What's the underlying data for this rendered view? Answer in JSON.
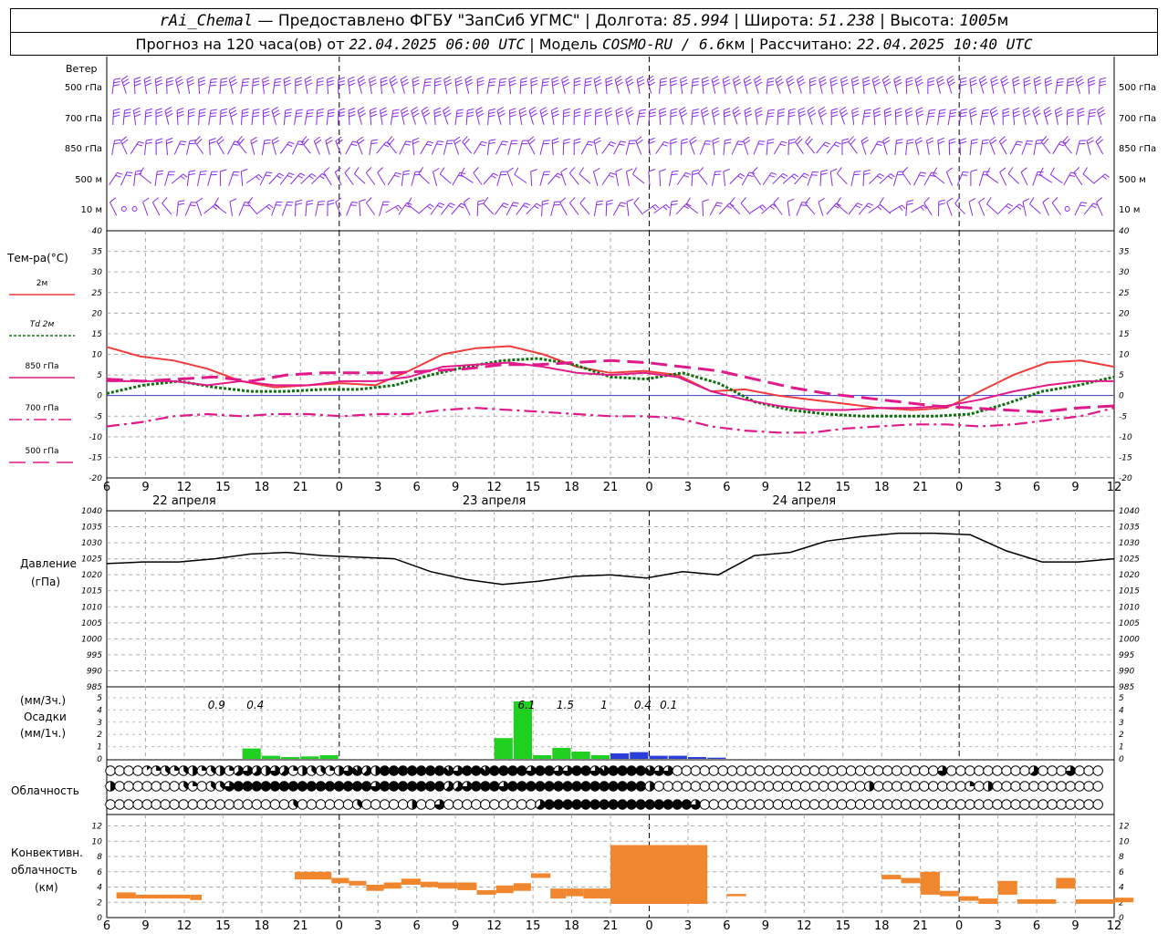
{
  "header": {
    "station": "rAi_Chemal",
    "provider": "— Предоставлено ФГБУ \"ЗапСиб УГМС\"",
    "lon_label": "| Долгота:",
    "lon_value": "85.994",
    "lat_label": "| Широта:",
    "lat_value": "51.238",
    "alt_label": "| Высота:",
    "alt_value": "1005",
    "alt_unit": "м",
    "forecast_label": "Прогноз на 120 часа(ов) от",
    "forecast_start": "22.04.2025 06:00 UTC",
    "model_label": "| Модель",
    "model_name": "COSMO-RU / 6.6",
    "model_unit": "км",
    "calc_label": "| Рассчитано:",
    "calc_time": "22.04.2025 10:40 UTC"
  },
  "wind_panel": {
    "title": "Ветер",
    "levels": [
      "500 гПа",
      "700 гПа",
      "850 гПа",
      "500 м",
      "10 м"
    ],
    "right_levels": [
      "500 гПа",
      "700 гПа",
      "850 гПа",
      "500 м",
      "10 м"
    ]
  },
  "temp_panel": {
    "title": "Тем-ра(°C)",
    "legend": [
      {
        "label": "2м",
        "color": "#f03c3c",
        "style": "solid"
      },
      {
        "label": "Td  2м",
        "color": "#107010",
        "style": "dotted"
      },
      {
        "label": "850 гПа",
        "color": "#e01a8a",
        "style": "solid"
      },
      {
        "label": "700 гПа",
        "color": "#e01a8a",
        "style": "dashdot"
      },
      {
        "label": "500 гПа",
        "color": "#e01a8a",
        "style": "dashed"
      }
    ]
  },
  "pressure_panel": {
    "title": "Давление",
    "unit": "(гПа)"
  },
  "precip_panel": {
    "unit_3h": "(мм/3ч.)",
    "title": "Осадки",
    "unit_1h": "(мм/1ч.)"
  },
  "cloud_panel": {
    "title": "Облачность"
  },
  "conv_panel": {
    "title_1": "Конвективн.",
    "title_2": "облачность",
    "unit": "(км)"
  },
  "time_axis": {
    "hours": [
      "6",
      "9",
      "12",
      "15",
      "18",
      "21",
      "0",
      "3",
      "6",
      "9",
      "12",
      "15",
      "18",
      "21",
      "0",
      "3",
      "6",
      "9",
      "12",
      "15",
      "18",
      "21",
      "0",
      "3",
      "6",
      "9",
      "12"
    ],
    "day_labels": [
      "22 апреля",
      "23 апреля",
      "24 апреля"
    ]
  },
  "chart_data": [
    {
      "type": "line",
      "name": "temperature",
      "x_hours": [
        0,
        3,
        6,
        9,
        12,
        15,
        18,
        21,
        24,
        27,
        30,
        33,
        36,
        39,
        42,
        45,
        48,
        51,
        54,
        57,
        60,
        63,
        66,
        69,
        72,
        75,
        78
      ],
      "ylim": [
        -20,
        40
      ],
      "yticks": [
        -20,
        -15,
        -10,
        -5,
        0,
        5,
        10,
        15,
        20,
        25,
        30,
        35,
        40
      ],
      "series": [
        {
          "name": "2м",
          "color": "#f03c3c",
          "style": "solid",
          "values": [
            11.8,
            9.5,
            8.5,
            6.5,
            3.5,
            2,
            2.5,
            3,
            2.5,
            6,
            10,
            11.5,
            12,
            10,
            7,
            5.5,
            6,
            5,
            1,
            1.5,
            0,
            -1,
            -2,
            -3,
            -3.5,
            -3,
            1,
            5,
            8,
            8.5,
            7
          ]
        },
        {
          "name": "Td 2м",
          "color": "#107010",
          "style": "dotted",
          "values": [
            0.5,
            2.5,
            3.5,
            2,
            1,
            1,
            1.5,
            1.5,
            2.5,
            5,
            7,
            8.5,
            9,
            7.5,
            4.5,
            4,
            5.5,
            3,
            -1.5,
            -3.5,
            -4.5,
            -5,
            -5,
            -5,
            -4.5,
            -2,
            1,
            2.5,
            4.5
          ]
        },
        {
          "name": "850 гПа",
          "color": "#e01a8a",
          "style": "solid",
          "values": [
            3.5,
            3.5,
            3.5,
            2.5,
            3.5,
            2.5,
            2.5,
            3.5,
            3.5,
            4.5,
            7,
            7.5,
            8,
            7,
            5.5,
            5,
            5.5,
            4.5,
            1,
            -1,
            -2.5,
            -3.5,
            -3.5,
            -3,
            -3,
            -2.5,
            -1,
            1,
            2.5,
            3.5,
            3.5
          ]
        },
        {
          "name": "700 гПа",
          "color": "#e01a8a",
          "style": "dashdot",
          "values": [
            -7.5,
            -6.5,
            -5,
            -4.5,
            -5,
            -4.5,
            -4.5,
            -5,
            -4.5,
            -4.5,
            -3.5,
            -3,
            -3.5,
            -4,
            -4.5,
            -5,
            -5,
            -5.5,
            -7.5,
            -8.5,
            -9,
            -9,
            -8,
            -7.5,
            -7,
            -7,
            -7.5,
            -7,
            -6,
            -5,
            -3
          ]
        },
        {
          "name": "500 гПа",
          "color": "#e01a8a",
          "style": "dashed",
          "values": [
            4,
            3.5,
            4,
            4.5,
            3.5,
            5,
            5.5,
            5.5,
            5.5,
            6,
            6.5,
            7.5,
            7.5,
            8,
            8.5,
            8,
            7,
            6,
            4,
            2,
            0.5,
            -0.5,
            -1.5,
            -2.5,
            -3,
            -3.5,
            -4,
            -3,
            -2.5
          ]
        }
      ]
    },
    {
      "type": "line",
      "name": "pressure",
      "ylim": [
        985,
        1040
      ],
      "yticks": [
        985,
        990,
        995,
        1000,
        1005,
        1010,
        1015,
        1020,
        1025,
        1030,
        1035,
        1040
      ],
      "values": [
        1023.5,
        1024,
        1024,
        1025,
        1026.5,
        1027,
        1026,
        1025.5,
        1025,
        1021,
        1018.5,
        1017,
        1018,
        1019.5,
        1020,
        1019,
        1021,
        1020,
        1026,
        1027,
        1030.5,
        1032,
        1033,
        1033,
        1032.5,
        1027.5,
        1024,
        1024,
        1025
      ]
    },
    {
      "type": "bar",
      "name": "precipitation",
      "ylim": [
        0,
        5
      ],
      "yticks": [
        0,
        1,
        2,
        3,
        4,
        5
      ],
      "labels": [
        {
          "hour": 8.5,
          "text": "0.9"
        },
        {
          "hour": 11.5,
          "text": "0.4"
        },
        {
          "hour": 32.5,
          "text": "6.1"
        },
        {
          "hour": 35.5,
          "text": "1.5"
        },
        {
          "hour": 38.5,
          "text": "1"
        },
        {
          "hour": 41.5,
          "text": "0.4"
        },
        {
          "hour": 43.5,
          "text": "0.1"
        }
      ],
      "bars": [
        {
          "h0": 7,
          "h1": 8,
          "v": 0.85,
          "c": "#20d020"
        },
        {
          "h0": 8,
          "h1": 9,
          "v": 0.25,
          "c": "#20d020"
        },
        {
          "h0": 9,
          "h1": 10,
          "v": 0.15,
          "c": "#20d020"
        },
        {
          "h0": 10,
          "h1": 11,
          "v": 0.2,
          "c": "#20d020"
        },
        {
          "h0": 11,
          "h1": 12,
          "v": 0.3,
          "c": "#20d020"
        },
        {
          "h0": 20,
          "h1": 21,
          "v": 1.7,
          "c": "#20d020"
        },
        {
          "h0": 21,
          "h1": 22,
          "v": 4.7,
          "c": "#20d020"
        },
        {
          "h0": 22,
          "h1": 23,
          "v": 0.3,
          "c": "#20d020"
        },
        {
          "h0": 23,
          "h1": 24,
          "v": 0.9,
          "c": "#20d020"
        },
        {
          "h0": 24,
          "h1": 25,
          "v": 0.6,
          "c": "#20d020"
        },
        {
          "h0": 25,
          "h1": 26,
          "v": 0.3,
          "c": "#20d020"
        },
        {
          "h0": 26,
          "h1": 27,
          "v": 0.45,
          "c": "#2b3fd8"
        },
        {
          "h0": 27,
          "h1": 28,
          "v": 0.55,
          "c": "#2b3fd8"
        },
        {
          "h0": 28,
          "h1": 29,
          "v": 0.25,
          "c": "#2b3fd8"
        },
        {
          "h0": 29,
          "h1": 30,
          "v": 0.25,
          "c": "#2b3fd8"
        },
        {
          "h0": 30,
          "h1": 31,
          "v": 0.15,
          "c": "#2b3fd8"
        },
        {
          "h0": 31,
          "h1": 32,
          "v": 0.1,
          "c": "#2b3fd8"
        }
      ]
    },
    {
      "type": "bar",
      "name": "convective_cloud",
      "ylim": [
        0,
        12
      ],
      "yticks": [
        0,
        2,
        4,
        6,
        8,
        10,
        12
      ],
      "color": "#f0872e",
      "blocks": [
        {
          "h0": 0.5,
          "h1": 1.5,
          "lo": 2.5,
          "hi": 3.3
        },
        {
          "h0": 1.5,
          "h1": 4.3,
          "lo": 2.5,
          "hi": 3
        },
        {
          "h0": 4.3,
          "h1": 4.9,
          "lo": 2.3,
          "hi": 3
        },
        {
          "h0": 9.7,
          "h1": 11.6,
          "lo": 5,
          "hi": 6
        },
        {
          "h0": 11.6,
          "h1": 12.5,
          "lo": 4.5,
          "hi": 5.2
        },
        {
          "h0": 12.5,
          "h1": 13.4,
          "lo": 4.2,
          "hi": 4.8
        },
        {
          "h0": 13.4,
          "h1": 14.3,
          "lo": 3.5,
          "hi": 4.3
        },
        {
          "h0": 14.3,
          "h1": 15.2,
          "lo": 3.8,
          "hi": 4.6
        },
        {
          "h0": 15.2,
          "h1": 16.2,
          "lo": 4.3,
          "hi": 5.1
        },
        {
          "h0": 16.2,
          "h1": 17.1,
          "lo": 4,
          "hi": 4.7
        },
        {
          "h0": 17.1,
          "h1": 18.1,
          "lo": 3.8,
          "hi": 4.6
        },
        {
          "h0": 18.1,
          "h1": 19.1,
          "lo": 3.6,
          "hi": 4.6
        },
        {
          "h0": 19.1,
          "h1": 20.1,
          "lo": 3,
          "hi": 3.6
        },
        {
          "h0": 20.1,
          "h1": 21,
          "lo": 3.2,
          "hi": 4.2
        },
        {
          "h0": 21,
          "h1": 21.9,
          "lo": 3.5,
          "hi": 4.5
        },
        {
          "h0": 21.9,
          "h1": 22.9,
          "lo": 5.2,
          "hi": 5.8
        },
        {
          "h0": 22.9,
          "h1": 23.7,
          "lo": 2.5,
          "hi": 3.8
        },
        {
          "h0": 23.7,
          "h1": 24.6,
          "lo": 2.8,
          "hi": 3.8
        },
        {
          "h0": 24.6,
          "h1": 26,
          "lo": 2.5,
          "hi": 3.8
        },
        {
          "h0": 26,
          "h1": 31,
          "lo": 1.8,
          "hi": 9.5
        },
        {
          "h0": 32,
          "h1": 33,
          "lo": 2.8,
          "hi": 3.1
        },
        {
          "h0": 40,
          "h1": 41,
          "lo": 5,
          "hi": 5.6
        },
        {
          "h0": 41,
          "h1": 42,
          "lo": 4.5,
          "hi": 5.2
        },
        {
          "h0": 42,
          "h1": 43,
          "lo": 3,
          "hi": 6
        },
        {
          "h0": 43,
          "h1": 44,
          "lo": 2.8,
          "hi": 3.5
        },
        {
          "h0": 44,
          "h1": 45,
          "lo": 2.2,
          "hi": 2.8
        },
        {
          "h0": 45,
          "h1": 46,
          "lo": 1.8,
          "hi": 2.5
        },
        {
          "h0": 46,
          "h1": 47,
          "lo": 3,
          "hi": 4.8
        },
        {
          "h0": 47,
          "h1": 49,
          "lo": 1.8,
          "hi": 2.4
        },
        {
          "h0": 49,
          "h1": 50,
          "lo": 3.8,
          "hi": 5.2
        },
        {
          "h0": 50,
          "h1": 52,
          "lo": 1.8,
          "hi": 2.4
        },
        {
          "h0": 52,
          "h1": 53,
          "lo": 2,
          "hi": 2.6
        }
      ]
    },
    {
      "type": "table",
      "name": "cloud_cover_octas",
      "note": "rows: upper, middle, lower; 0=clear .. 8=overcast",
      "rows": [
        [
          0,
          0,
          0,
          0,
          1,
          2,
          3,
          2,
          3,
          4,
          2,
          3,
          4,
          2,
          5,
          6,
          5,
          4,
          6,
          5,
          2,
          4,
          3,
          3,
          2,
          4,
          6,
          7,
          5,
          4,
          8,
          8,
          8,
          8,
          8,
          8,
          8,
          7,
          6,
          8,
          8,
          7,
          8,
          8,
          8,
          8,
          6,
          8,
          8,
          6,
          6,
          8,
          8,
          6,
          7,
          8,
          8,
          8,
          8,
          7,
          6,
          6,
          0,
          0,
          0,
          0,
          0,
          0,
          0,
          0,
          0,
          0,
          0,
          0,
          0,
          0,
          0,
          0,
          0,
          0,
          0,
          0,
          0,
          0,
          0,
          0,
          0,
          0,
          0,
          0,
          0,
          6,
          0,
          0,
          0,
          0,
          0,
          0,
          0,
          0,
          0,
          5,
          0,
          0,
          0,
          6,
          0,
          0,
          0
        ],
        [
          4,
          0,
          0,
          0,
          0,
          0,
          0,
          0,
          3,
          2,
          0,
          3,
          3,
          6,
          8,
          8,
          8,
          8,
          8,
          8,
          8,
          8,
          8,
          8,
          8,
          8,
          8,
          8,
          8,
          6,
          8,
          8,
          8,
          8,
          8,
          8,
          8,
          5,
          5,
          6,
          8,
          8,
          8,
          6,
          8,
          8,
          8,
          8,
          8,
          8,
          8,
          8,
          8,
          8,
          8,
          8,
          8,
          8,
          8,
          4,
          0,
          0,
          0,
          0,
          0,
          0,
          0,
          0,
          0,
          0,
          0,
          0,
          0,
          0,
          0,
          0,
          0,
          0,
          0,
          0,
          0,
          0,
          0,
          4,
          0,
          0,
          0,
          0,
          0,
          0,
          0,
          0,
          0,
          0,
          2,
          0,
          4,
          0,
          0,
          0,
          0,
          0,
          0,
          0,
          0,
          0,
          0,
          0,
          0
        ],
        [
          0,
          0,
          0,
          0,
          0,
          0,
          0,
          0,
          0,
          0,
          0,
          0,
          0,
          0,
          0,
          0,
          0,
          0,
          0,
          0,
          3,
          0,
          0,
          0,
          0,
          0,
          0,
          3,
          0,
          0,
          0,
          0,
          0,
          4,
          0,
          0,
          6,
          0,
          0,
          0,
          0,
          0,
          0,
          0,
          0,
          0,
          0,
          5,
          8,
          8,
          8,
          8,
          8,
          8,
          8,
          8,
          8,
          8,
          8,
          8,
          8,
          8,
          8,
          8,
          6,
          0,
          0,
          0,
          0,
          0,
          0,
          0,
          0,
          0,
          0,
          0,
          0,
          0,
          0,
          0,
          0,
          0,
          0,
          0,
          0,
          0,
          0,
          0,
          0,
          0,
          0,
          0,
          0,
          0,
          0,
          0,
          0,
          0,
          0,
          0,
          0,
          0,
          0,
          0,
          0,
          0,
          0,
          0,
          0
        ]
      ]
    }
  ]
}
